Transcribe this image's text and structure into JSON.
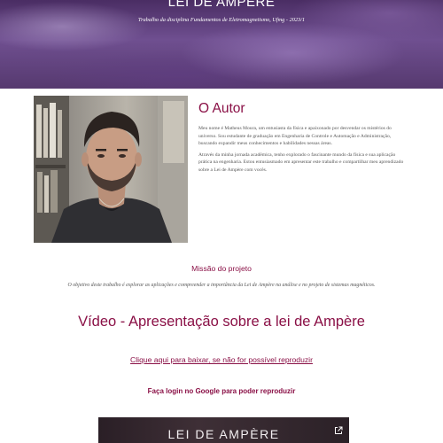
{
  "hero": {
    "title": "LEI DE AMPÈRE",
    "subtitle": "Trabalho da disciplina Fundamentos de Eletromagnetismo, Ufmg - 2023/1"
  },
  "author": {
    "heading": "O Autor",
    "photo_icon": "author-photo",
    "bio": [
      "Meu nome é Matheus Moura, um entusiasta da física e apaixonado por desvendar os mistérios do universo. Sou estudante de graduação em Engenharia de Controle e Automação e Administração, buscando expandir meus conhecimentos e habilidades nessas áreas.",
      "Através da minha jornada acadêmica, tenho explorado o fascinante mundo da física e sua aplicação prática na engenharia. Estou entusiasmado em apresentar este trabalho e compartilhar meu aprendizado sobre a Lei de Ampère com vocês."
    ]
  },
  "mission": {
    "heading": "Missão do projeto",
    "text": "O objetivo deste trabalho é explorar as aplicações e compreender a importância da Lei de Ampère na análise e no projeto de sistemas magnéticos."
  },
  "video": {
    "heading": "Vídeo - Apresentação sobre a lei de Ampère",
    "download_link": "Clique aqui para baixar, se não for possível reproduzir",
    "login_note": "Faça login no Google para poder reproduzir",
    "embed_title": "LEI DE AMPÈRE",
    "open_icon": "open-in-new-icon"
  },
  "colors": {
    "accent": "#8a1046",
    "hero_bg": "#5e3f7c",
    "body_text": "#555555"
  }
}
